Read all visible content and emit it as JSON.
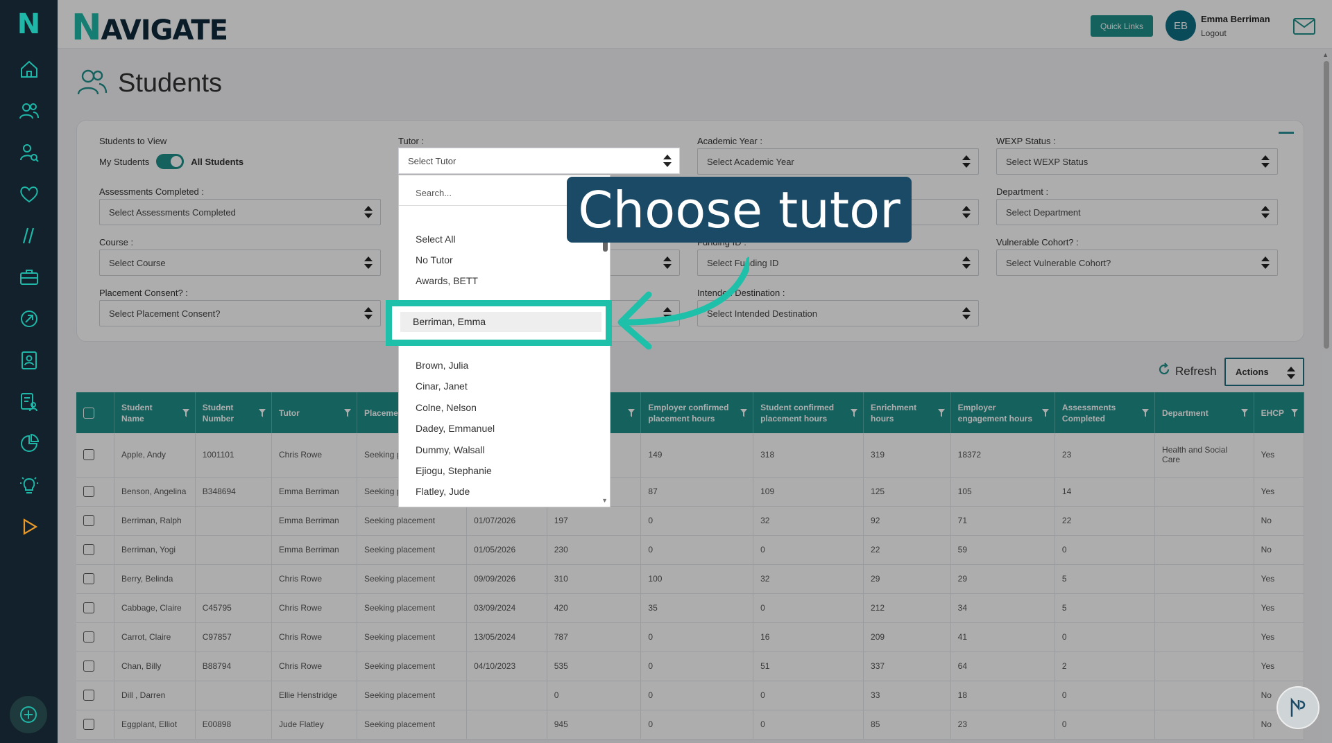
{
  "app": {
    "brand_initial": "N",
    "brand_rest": "AVIGATE",
    "quick_links": "Quick Links",
    "user_initials": "EB",
    "user_name": "Emma Berriman",
    "logout": "Logout"
  },
  "page": {
    "title": "Students"
  },
  "filters": {
    "students_to_view": "Students to View",
    "my_students": "My Students",
    "all_students": "All Students",
    "tutor_label": "Tutor :",
    "tutor_value": "Select Tutor",
    "academic_year_label": "Academic Year :",
    "academic_year_value": "Select Academic Year",
    "wexp_label": "WEXP Status :",
    "wexp_value": "Select WEXP Status",
    "assessments_label": "Assessments Completed :",
    "assessments_value": "Select Assessments Completed",
    "department_label": "Department :",
    "department_value": "Select Department",
    "course_label": "Course :",
    "course_value": "Select Course",
    "funding_label": "Funding ID :",
    "funding_value": "Select Funding ID",
    "vulnerable_label": "Vulnerable Cohort? :",
    "vulnerable_value": "Select Vulnerable Cohort?",
    "placement_consent_label": "Placement Consent? :",
    "placement_consent_value": "Select Placement Consent?",
    "intended_dest_label": "Intended Destination :",
    "intended_dest_value": "Select Intended Destination"
  },
  "dropdown": {
    "search_placeholder": "Search...",
    "items": [
      "Select All",
      "No Tutor",
      "Awards, BETT",
      "Berriman, Emma",
      "Brown, Julia",
      "Cinar, Janet",
      "Colne, Nelson",
      "Dadey, Emmanuel",
      "Dummy, Walsall",
      "Ejiogu, Stephanie",
      "Flatley, Jude"
    ]
  },
  "callout": {
    "text": "Choose tutor"
  },
  "toolbar": {
    "refresh": "Refresh",
    "actions": "Actions"
  },
  "table": {
    "headers": [
      "Student Name",
      "Student Number",
      "Tutor",
      "Placement",
      "",
      "",
      "Employer confirmed placement hours",
      "Student confirmed placement hours",
      "Enrichment hours",
      "Employer engagement hours",
      "Assessments Completed",
      "Department",
      "EHCP"
    ],
    "rows": [
      [
        "Apple, Andy",
        "1001101",
        "Chris Rowe",
        "Seeking pla",
        "",
        "",
        "149",
        "318",
        "319",
        "18372",
        "23",
        "Health and Social Care",
        "Yes"
      ],
      [
        "Benson, Angelina",
        "B348694",
        "Emma Berriman",
        "Seeking pla",
        "",
        "",
        "87",
        "109",
        "125",
        "105",
        "14",
        "",
        "Yes"
      ],
      [
        "Berriman, Ralph",
        "",
        "Emma Berriman",
        "Seeking placement",
        "01/07/2026",
        "197",
        "0",
        "32",
        "92",
        "71",
        "22",
        "",
        "No"
      ],
      [
        "Berriman, Yogi",
        "",
        "Emma Berriman",
        "Seeking placement",
        "01/05/2026",
        "230",
        "0",
        "0",
        "22",
        "59",
        "0",
        "",
        "No"
      ],
      [
        "Berry, Belinda",
        "",
        "Chris Rowe",
        "Seeking placement",
        "09/09/2026",
        "310",
        "100",
        "32",
        "29",
        "29",
        "5",
        "",
        "Yes"
      ],
      [
        "Cabbage, Claire",
        "C45795",
        "Chris Rowe",
        "Seeking placement",
        "03/09/2024",
        "420",
        "35",
        "0",
        "212",
        "34",
        "5",
        "",
        "Yes"
      ],
      [
        "Carrot, Claire",
        "C97857",
        "Chris Rowe",
        "Seeking placement",
        "13/05/2024",
        "787",
        "0",
        "16",
        "209",
        "41",
        "0",
        "",
        "Yes"
      ],
      [
        "Chan, Billy",
        "B88794",
        "Chris Rowe",
        "Seeking placement",
        "04/10/2023",
        "535",
        "0",
        "51",
        "337",
        "64",
        "2",
        "",
        "Yes"
      ],
      [
        "Dill , Darren",
        "",
        "Ellie Henstridge",
        "Seeking placement",
        "",
        "0",
        "0",
        "0",
        "33",
        "18",
        "0",
        "",
        "No"
      ],
      [
        "Eggplant, Elliot",
        "E00898",
        "Jude Flatley",
        "Seeking placement",
        "",
        "945",
        "0",
        "0",
        "85",
        "23",
        "0",
        "",
        "No"
      ]
    ]
  }
}
